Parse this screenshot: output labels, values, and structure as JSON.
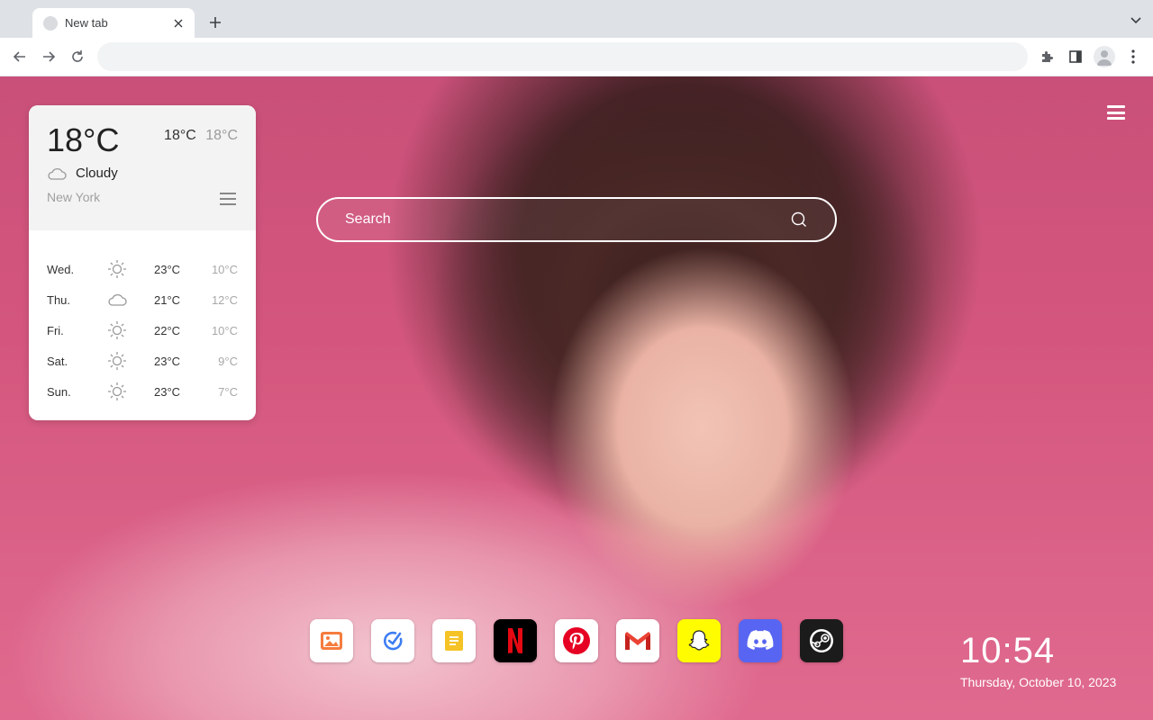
{
  "browser": {
    "tab_title": "New tab",
    "omnibox_value": ""
  },
  "weather": {
    "current_temp": "18°C",
    "high": "18°C",
    "low": "18°C",
    "condition": "Cloudy",
    "city": "New York",
    "forecast": [
      {
        "day": "Wed.",
        "icon": "sun-icon",
        "high": "23°C",
        "low": "10°C"
      },
      {
        "day": "Thu.",
        "icon": "cloud-icon",
        "high": "21°C",
        "low": "12°C"
      },
      {
        "day": "Fri.",
        "icon": "sun-icon",
        "high": "22°C",
        "low": "10°C"
      },
      {
        "day": "Sat.",
        "icon": "sun-icon",
        "high": "23°C",
        "low": "9°C"
      },
      {
        "day": "Sun.",
        "icon": "sun-icon",
        "high": "23°C",
        "low": "7°C"
      }
    ]
  },
  "search": {
    "placeholder": "Search"
  },
  "dock": {
    "apps": [
      {
        "name": "photos-icon",
        "bg": "#ffffff"
      },
      {
        "name": "task-check-icon",
        "bg": "#ffffff"
      },
      {
        "name": "notes-icon",
        "bg": "#ffffff"
      },
      {
        "name": "netflix-icon",
        "bg": "#000000"
      },
      {
        "name": "pinterest-icon",
        "bg": "#ffffff"
      },
      {
        "name": "gmail-icon",
        "bg": "#ffffff"
      },
      {
        "name": "snapchat-icon",
        "bg": "#fffc00"
      },
      {
        "name": "discord-icon",
        "bg": "#5865f2"
      },
      {
        "name": "steam-icon",
        "bg": "#1b1b1b"
      }
    ]
  },
  "clock": {
    "time": "10:54",
    "date": "Thursday, October 10, 2023"
  },
  "colors": {
    "accent_pink": "#d4567e",
    "netflix_red": "#e50914",
    "pinterest_red": "#e60023"
  }
}
